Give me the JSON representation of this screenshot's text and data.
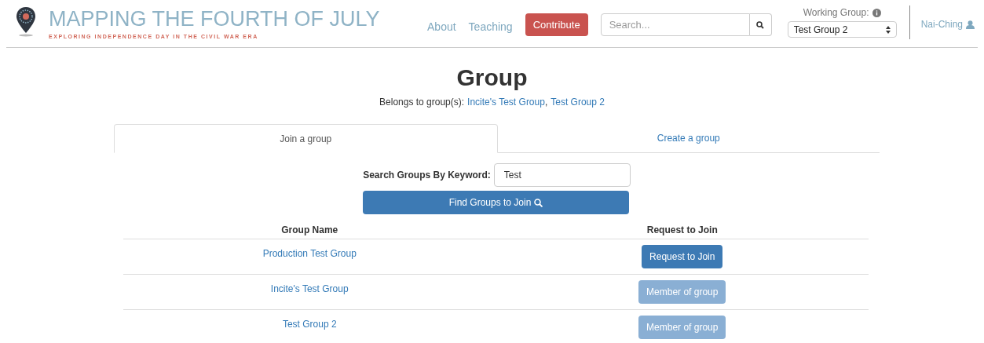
{
  "header": {
    "title": "MAPPING THE FOURTH OF JULY",
    "subtitle": "EXPLORING INDEPENDENCE DAY IN THE CIVIL WAR ERA",
    "nav": [
      "About",
      "Teaching"
    ],
    "contribute": "Contribute",
    "search": {
      "placeholder": "Search..."
    },
    "working_group": {
      "label": "Working Group:",
      "value": "Test Group 2"
    },
    "user": "Nai-Ching"
  },
  "page": {
    "title": "Group",
    "belongs_label": "Belongs to group(s):",
    "groups": [
      "Incite's Test Group",
      "Test Group 2"
    ],
    "separator": ","
  },
  "tabs": [
    {
      "label": "Join a group",
      "selected": true
    },
    {
      "label": "Create a group",
      "selected": false
    }
  ],
  "search_form": {
    "label": "Search Groups By Keyword:",
    "value": "Test",
    "button": "Find Groups to Join"
  },
  "table": {
    "columns": [
      "Group Name",
      "Request to Join"
    ],
    "rows": [
      {
        "name": "Production Test Group",
        "action": "Request to Join",
        "disabled": false
      },
      {
        "name": "Incite's Test Group",
        "action": "Member of group",
        "disabled": true
      },
      {
        "name": "Test Group 2",
        "action": "Member of group",
        "disabled": true
      }
    ]
  }
}
